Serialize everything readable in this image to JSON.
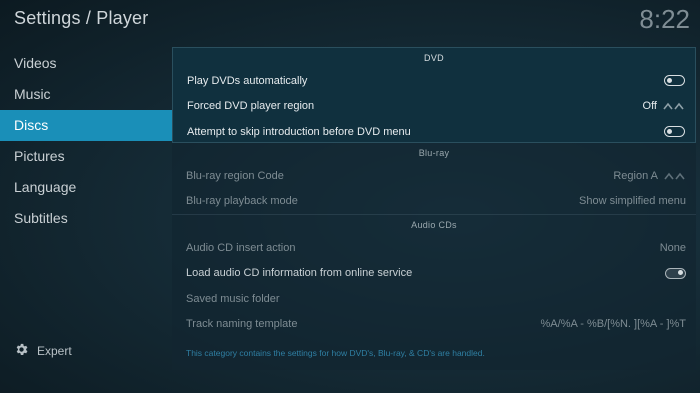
{
  "header": {
    "title": "Settings / Player",
    "clock": "8:22"
  },
  "sidebar": {
    "items": [
      {
        "label": "Videos"
      },
      {
        "label": "Music"
      },
      {
        "label": "Discs"
      },
      {
        "label": "Pictures"
      },
      {
        "label": "Language"
      },
      {
        "label": "Subtitles"
      }
    ],
    "active_index": 2,
    "expert_label": "Expert"
  },
  "sections": {
    "dvd": {
      "header": "DVD",
      "rows": [
        {
          "label": "Play DVDs automatically",
          "value": "",
          "control": "toggle-off"
        },
        {
          "label": "Forced DVD player region",
          "value": "Off",
          "control": "spinner"
        },
        {
          "label": "Attempt to skip introduction before DVD menu",
          "value": "",
          "control": "toggle-off"
        }
      ]
    },
    "bluray": {
      "header": "Blu-ray",
      "rows": [
        {
          "label": "Blu-ray region Code",
          "value": "Region A",
          "control": "spinner"
        },
        {
          "label": "Blu-ray playback mode",
          "value": "Show simplified menu",
          "control": ""
        }
      ]
    },
    "audiocds": {
      "header": "Audio CDs",
      "rows": [
        {
          "label": "Audio CD insert action",
          "value": "None",
          "control": ""
        },
        {
          "label": "Load audio CD information from online service",
          "value": "",
          "control": "toggle-on"
        },
        {
          "label": "Saved music folder",
          "value": "",
          "control": ""
        },
        {
          "label": "Track naming template",
          "value": "%A/%A - %B/[%N. ][%A - ]%T",
          "control": ""
        }
      ]
    }
  },
  "footer": {
    "description": "This category contains the settings for how DVD's, Blu-ray, & CD's are handled."
  },
  "colors": {
    "accent": "#1a8fb8",
    "background": "#152b36",
    "hint_text": "#2f7fa3"
  }
}
